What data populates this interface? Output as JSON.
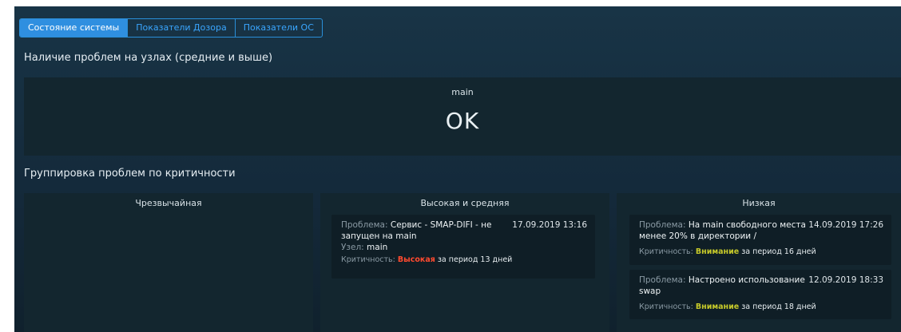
{
  "tabs": [
    {
      "label": "Состояние системы",
      "active": true
    },
    {
      "label": "Показатели Дозора",
      "active": false
    },
    {
      "label": "Показатели ОС",
      "active": false
    }
  ],
  "nodes_section": {
    "title": "Наличие проблем на узлах (средние и выше)",
    "node_name": "main",
    "status": "OK"
  },
  "grouping_section": {
    "title": "Группировка проблем по критичности",
    "columns": [
      {
        "title": "Чрезвычайная"
      },
      {
        "title": "Высокая и средняя"
      },
      {
        "title": "Низкая"
      }
    ]
  },
  "cards": {
    "high_1": {
      "problem_label": "Проблема:",
      "problem_text": "Сервис - SMAP-DIFI - не запущен на main",
      "date": "17.09.2019 13:16",
      "node_label": "Узел:",
      "node_value": "main",
      "crit_label": "Критичность:",
      "crit_value": "Высокая",
      "period": "за период 13 дней"
    },
    "low_1": {
      "problem_label": "Проблема:",
      "problem_text": "На main свободного места менее 20% в директории /",
      "date": "14.09.2019 17:26",
      "crit_label": "Критичность:",
      "crit_value": "Внимание",
      "period": "за период 16 дней"
    },
    "low_2": {
      "problem_label": "Проблема:",
      "problem_text": "Настроено использование swap",
      "date": "12.09.2019 18:33",
      "crit_label": "Критичность:",
      "crit_value": "Внимание",
      "period": "за период 18 дней"
    }
  },
  "colors": {
    "accent": "#2f8fe0",
    "severity_high": "#ff4a2f",
    "severity_warning": "#c6c92a",
    "panel_bg": "#13262f",
    "card_bg": "#0f1e26"
  }
}
